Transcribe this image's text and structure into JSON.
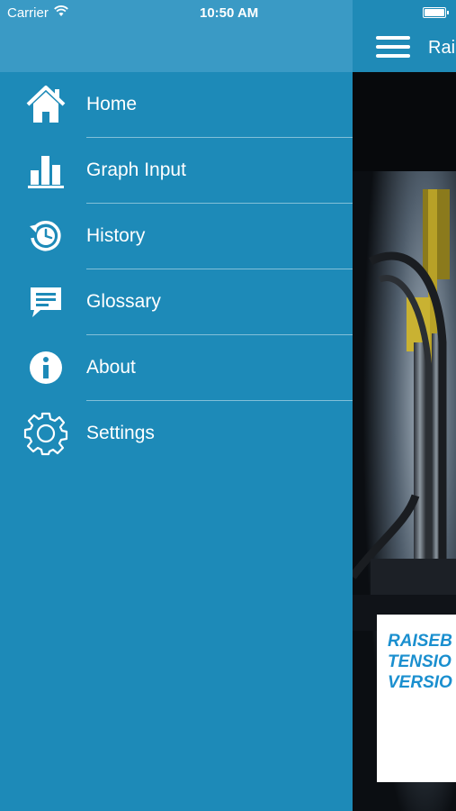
{
  "status_bar": {
    "carrier": "Carrier",
    "time": "10:50 AM"
  },
  "main_screen": {
    "title": "Rai",
    "card_lines": [
      "RAISEB",
      "TENSIO",
      "VERSIO"
    ]
  },
  "menu": {
    "items": [
      {
        "label": "Home",
        "icon": "home-icon"
      },
      {
        "label": "Graph Input",
        "icon": "bar-chart-icon"
      },
      {
        "label": "History",
        "icon": "history-clock-icon"
      },
      {
        "label": "Glossary",
        "icon": "speech-bubble-icon"
      },
      {
        "label": "About",
        "icon": "info-icon"
      },
      {
        "label": "Settings",
        "icon": "gear-icon"
      }
    ]
  },
  "colors": {
    "drawer_background": "#1d8ab8",
    "drawer_header": "#3a9ac5",
    "card_text": "#1a8fcf"
  }
}
